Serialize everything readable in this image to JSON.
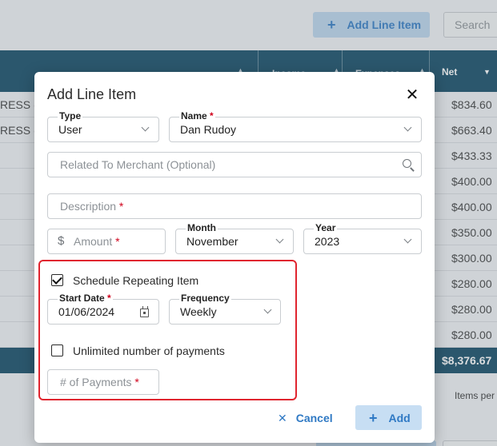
{
  "background": {
    "toolbar": {
      "add_line_item_label": "Add Line Item",
      "search_placeholder": "Search"
    },
    "table": {
      "headers": {
        "income": "Income",
        "expenses": "Expenses",
        "net": "Net"
      },
      "rows": [
        {
          "left": "RESS (",
          "net": "$834.60"
        },
        {
          "left": "RESS (",
          "net": "$663.40"
        },
        {
          "left": "",
          "net": "$433.33"
        },
        {
          "left": "",
          "net": "$400.00"
        },
        {
          "left": "",
          "net": "$400.00"
        },
        {
          "left": "",
          "net": "$350.00"
        },
        {
          "left": "",
          "net": "$300.00"
        },
        {
          "left": "",
          "net": "$280.00"
        },
        {
          "left": "",
          "net": "$280.00"
        },
        {
          "left": "",
          "net": "$280.00"
        }
      ],
      "total": "$8,376.67",
      "items_per_page_label": "Items per"
    }
  },
  "modal": {
    "title": "Add Line Item",
    "type": {
      "label": "Type",
      "value": "User"
    },
    "name": {
      "label": "Name",
      "value": "Dan Rudoy"
    },
    "merchant": {
      "placeholder": "Related To Merchant (Optional)"
    },
    "description": {
      "placeholder": "Description"
    },
    "amount": {
      "placeholder": "Amount",
      "currency_symbol": "$"
    },
    "month": {
      "label": "Month",
      "value": "November"
    },
    "year": {
      "label": "Year",
      "value": "2023"
    },
    "schedule": {
      "checkbox_label": "Schedule Repeating Item",
      "checked": true,
      "start_date": {
        "label": "Start Date",
        "value": "01/06/2024"
      },
      "frequency": {
        "label": "Frequency",
        "value": "Weekly"
      },
      "unlimited_label": "Unlimited number of payments",
      "unlimited_checked": false,
      "payments": {
        "placeholder": "# of Payments"
      }
    },
    "actions": {
      "cancel_label": "Cancel",
      "add_label": "Add"
    }
  },
  "colors": {
    "accent": "#2f79c4",
    "header_bg": "#0f4763",
    "highlight": "#e0252f",
    "required": "#d0021b"
  }
}
